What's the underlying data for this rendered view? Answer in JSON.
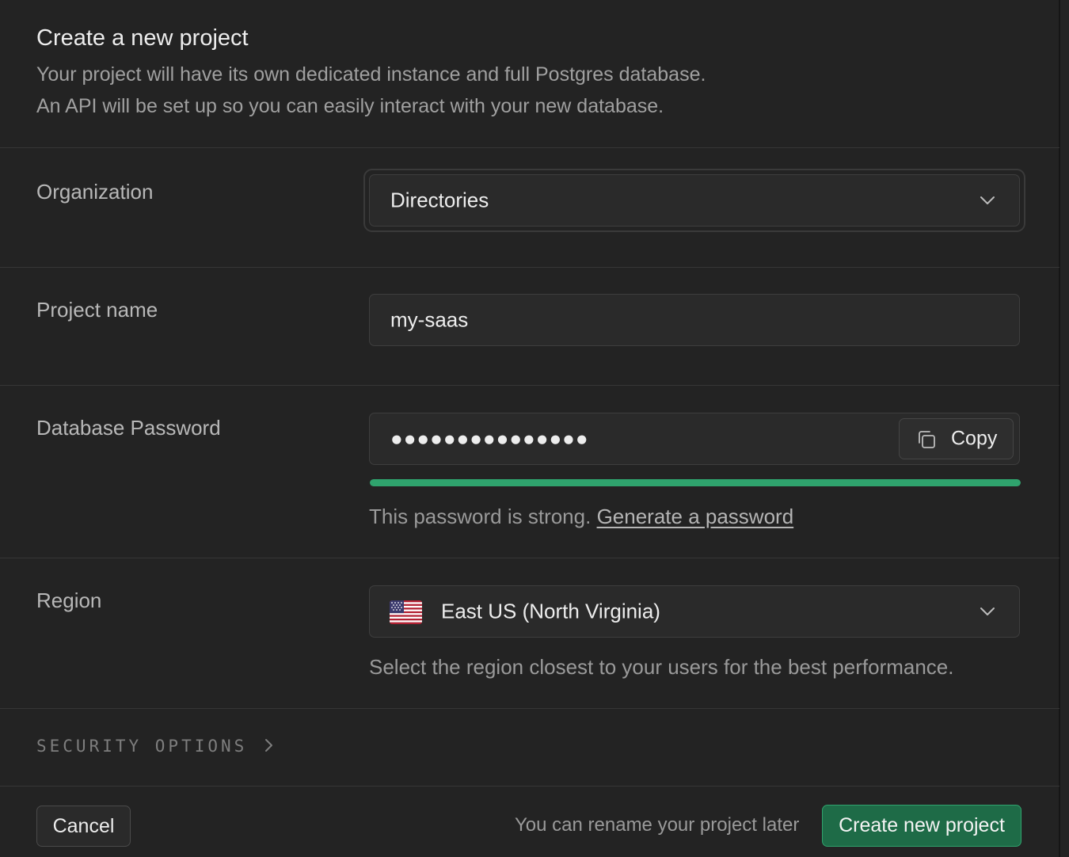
{
  "header": {
    "title": "Create a new project",
    "description_line1": "Your project will have its own dedicated instance and full Postgres database.",
    "description_line2": "An API will be set up so you can easily interact with your new database."
  },
  "organization": {
    "label": "Organization",
    "selected": "Directories",
    "icon": "chevron-down-icon"
  },
  "project_name": {
    "label": "Project name",
    "value": "my-saas"
  },
  "database_password": {
    "label": "Database Password",
    "masked_value": "●●●●●●●●●●●●●●●",
    "copy_label": "Copy",
    "copy_icon": "copy-icon",
    "strength_fraction": 1.0,
    "strength_color": "#2fa36d",
    "hint_text": "This password is strong.",
    "generate_link": "Generate a password"
  },
  "region": {
    "label": "Region",
    "selected": "East US (North Virginia)",
    "flag_icon": "us-flag-icon",
    "hint": "Select the region closest to your users for the best performance."
  },
  "security_options": {
    "label": "SECURITY OPTIONS",
    "icon": "chevron-right-icon"
  },
  "footer": {
    "cancel_label": "Cancel",
    "rename_note": "You can rename your project later",
    "create_label": "Create new project",
    "accent_color": "#1e6b47"
  }
}
